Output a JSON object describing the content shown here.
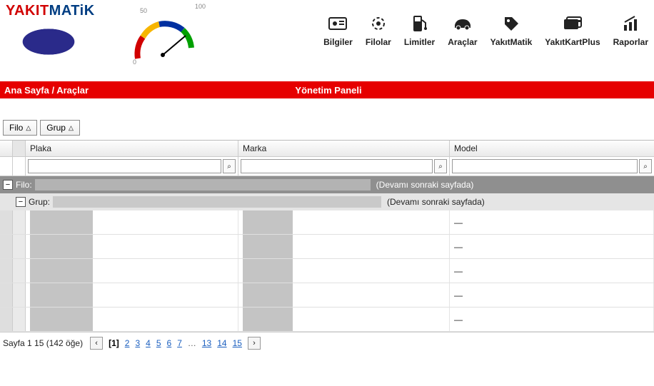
{
  "brand": {
    "part1": "YAKIT",
    "part2": "MATiK"
  },
  "gauge": {
    "min": "0",
    "mid": "50",
    "max": "100"
  },
  "nav": [
    {
      "id": "bilgiler",
      "label": "Bilgiler",
      "icon": "contact-card-icon"
    },
    {
      "id": "filolar",
      "label": "Filolar",
      "icon": "target-icon"
    },
    {
      "id": "limitler",
      "label": "Limitler",
      "icon": "fuel-pump-icon"
    },
    {
      "id": "araclar",
      "label": "Araçlar",
      "icon": "car-icon"
    },
    {
      "id": "yakitmatik",
      "label": "YakıtMatik",
      "icon": "tag-icon"
    },
    {
      "id": "yakitkartplus",
      "label": "YakıtKartPlus",
      "icon": "card-icon"
    },
    {
      "id": "raporlar",
      "label": "Raporlar",
      "icon": "chart-icon"
    }
  ],
  "redbar": {
    "breadcrumb": "Ana Sayfa / Araçlar",
    "title": "Yönetim Paneli"
  },
  "groupButtons": [
    {
      "id": "filo",
      "label": "Filo",
      "dir": "△"
    },
    {
      "id": "grup",
      "label": "Grup",
      "dir": "△"
    }
  ],
  "columns": {
    "plaka": "Plaka",
    "marka": "Marka",
    "model": "Model"
  },
  "filters": {
    "plaka": "",
    "marka": "",
    "model": ""
  },
  "groupHeaders": {
    "filoPrefix": "Filo:",
    "filoCont": "(Devamı sonraki sayfada)",
    "grupPrefix": "Grup:",
    "grupCont": "(Devamı sonraki sayfada)"
  },
  "rows": [
    {
      "plaka_redacted": true,
      "marka_redacted": true,
      "model": "—"
    },
    {
      "plaka_redacted": true,
      "marka_redacted": true,
      "model": "—"
    },
    {
      "plaka_redacted": true,
      "marka_redacted": true,
      "model": "—"
    },
    {
      "plaka_redacted": true,
      "marka_redacted": true,
      "model": "—"
    },
    {
      "plaka_redacted": true,
      "marka_redacted": true,
      "model": "—"
    }
  ],
  "pager": {
    "info": "Sayfa 1 15 (142 öğe)",
    "current": "[1]",
    "pages": [
      "2",
      "3",
      "4",
      "5",
      "6",
      "7"
    ],
    "ellipsis": "…",
    "tail": [
      "13",
      "14",
      "15"
    ]
  }
}
